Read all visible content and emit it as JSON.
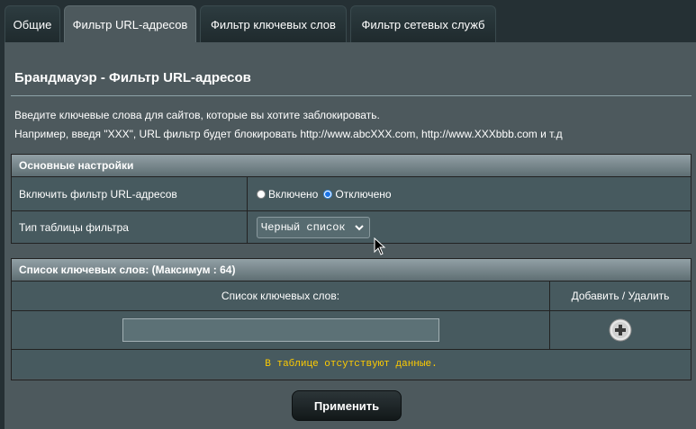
{
  "tabs": [
    {
      "label": "Общие",
      "active": false
    },
    {
      "label": "Фильтр URL-адресов",
      "active": true
    },
    {
      "label": "Фильтр ключевых слов",
      "active": false
    },
    {
      "label": "Фильтр сетевых служб",
      "active": false
    }
  ],
  "page": {
    "title": "Брандмауэр - Фильтр URL-адресов",
    "description_line1": "Введите ключевые слова для сайтов, которые вы хотите заблокировать.",
    "description_line2": "Например, введя \"XXX\", URL фильтр будет блокировать http://www.abcXXX.com, http://www.XXXbbb.com и т.д"
  },
  "basic_settings": {
    "header": "Основные настройки",
    "enable_filter": {
      "label": "Включить фильтр URL-адресов",
      "option_on": "Включено",
      "option_off": "Отключено",
      "selected": "off"
    },
    "filter_table_type": {
      "label": "Тип таблицы фильтра",
      "value": "Черный список"
    }
  },
  "keyword_list": {
    "header": "Список ключевых слов: (Максимум : 64)",
    "column_keywords": "Список ключевых слов:",
    "column_actions": "Добавить / Удалить",
    "input_value": "",
    "empty_message": "В таблице отсутствуют данные."
  },
  "apply_button": "Применить",
  "colors": {
    "background": "#253034",
    "panel": "#4d595d",
    "row": "#475a5f",
    "empty_text": "#ffcc00",
    "radio_selected": "#1a73e8"
  }
}
